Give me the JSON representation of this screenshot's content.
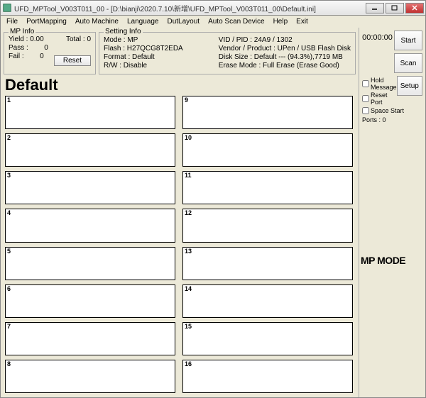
{
  "window": {
    "title": "UFD_MPTool_V003T011_00 - [D:\\bianji\\2020.7.10\\新增\\UFD_MPTool_V003T011_00\\Default.ini]"
  },
  "menu": {
    "file": "File",
    "portmapping": "PortMapping",
    "automachine": "Auto Machine",
    "language": "Language",
    "dutlayout": "DutLayout",
    "autoscandevice": "Auto Scan Device",
    "help": "Help",
    "exit": "Exit"
  },
  "mpinfo": {
    "legend": "MP Info",
    "yield_label": "Yield :",
    "yield_value": "0.00",
    "total_label": "Total :",
    "total_value": "0",
    "pass_label": "Pass :",
    "pass_value": "0",
    "fail_label": "Fail :",
    "fail_value": "0",
    "reset": "Reset"
  },
  "setting": {
    "legend": "Setting Info",
    "mode": "Mode : MP",
    "flash": "Flash : H27QCG8T2EDA",
    "format": "Format : Default",
    "rw": "R/W : Disable",
    "vidpid": "VID / PID : 24A9 / 1302",
    "vendor": "Vendor / Product : UPen / USB Flash Disk",
    "disksize": "Disk Size : Default --- (94.3%),7719 MB",
    "erasemode": "Erase Mode : Full Erase (Erase Good)"
  },
  "default_title": "Default",
  "slots": [
    "1",
    "2",
    "3",
    "4",
    "5",
    "6",
    "7",
    "8",
    "9",
    "10",
    "11",
    "12",
    "13",
    "14",
    "15",
    "16"
  ],
  "side": {
    "timer": "00:00:00",
    "start": "Start",
    "scan": "Scan",
    "setup": "Setup",
    "hold": "Hold Message",
    "reset_port": "Reset Port",
    "space_start": "Space Start",
    "ports_label": "Ports :",
    "ports_value": "0",
    "mpmode": "MP MODE"
  }
}
